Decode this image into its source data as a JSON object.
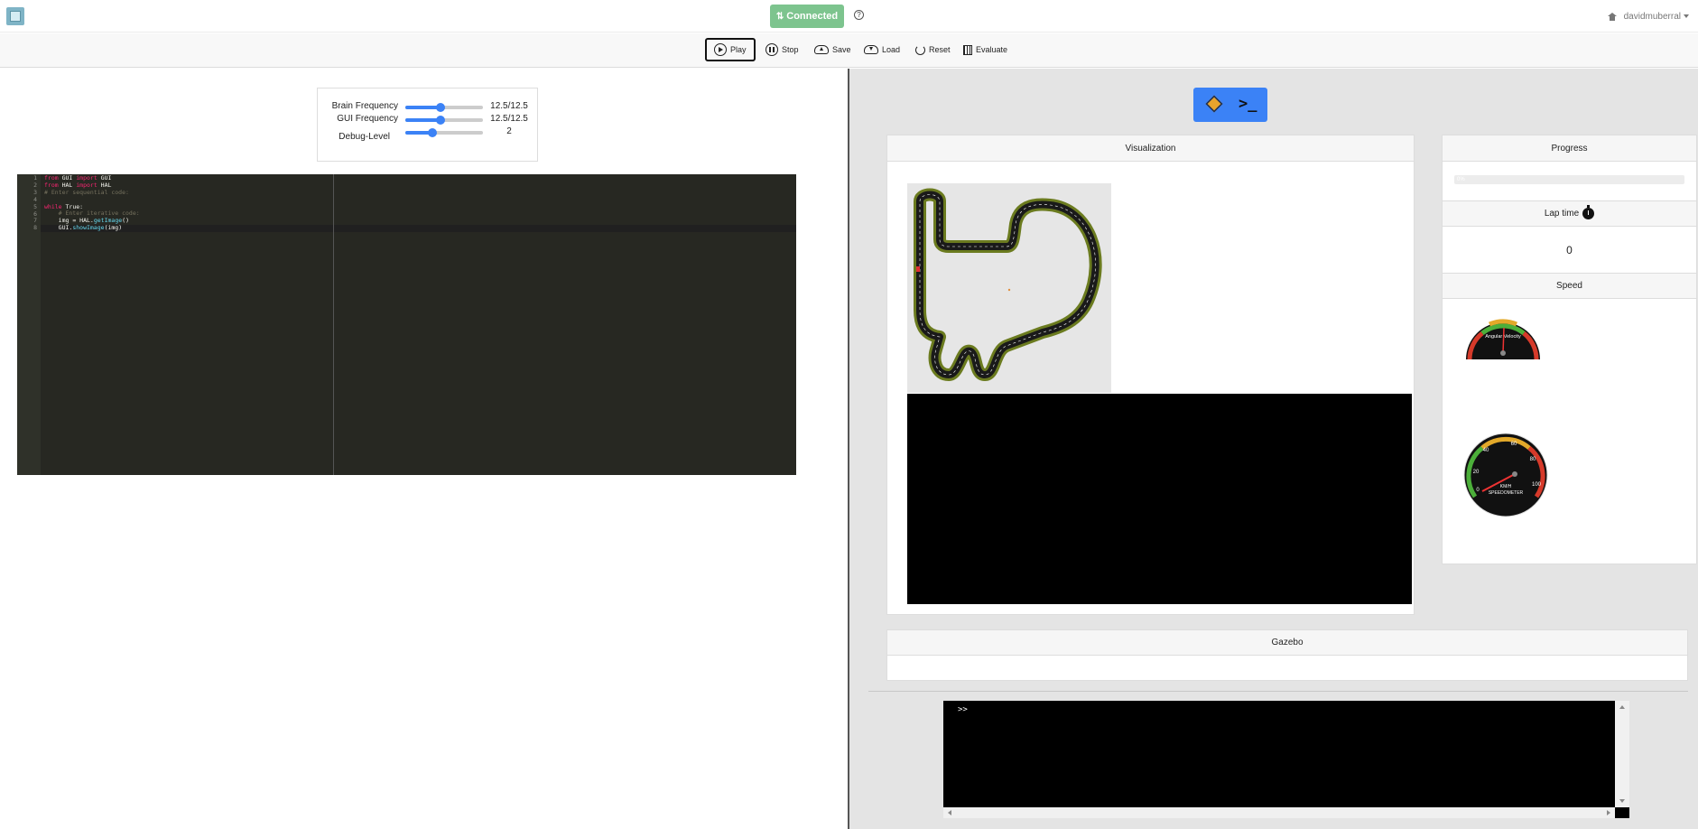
{
  "header": {
    "connection_status": "Connected",
    "help_symbol": "?",
    "username": "davidmuberral"
  },
  "toolbar": {
    "play": "Play",
    "stop": "Stop",
    "save": "Save",
    "load": "Load",
    "reset": "Reset",
    "evaluate": "Evaluate"
  },
  "frequencies": {
    "brain": {
      "label": "Brain Frequency",
      "value": "12.5/12.5",
      "level": 0.45
    },
    "gui": {
      "label": "GUI Frequency",
      "value": "12.5/12.5",
      "level": 0.45
    },
    "debug": {
      "label": "Debug-Level",
      "value": "2",
      "level": 0.35
    }
  },
  "editor": {
    "line_numbers": [
      "1",
      "2",
      "3",
      "4",
      "5",
      "6",
      "7",
      "8"
    ],
    "lines": [
      "from GUI import GUI",
      "from HAL import HAL",
      "# Enter sequential code:",
      "",
      "while True:",
      "    # Enter iterative code:",
      "    img = HAL.getImage()",
      "    GUI.showImage(img)"
    ]
  },
  "panels": {
    "visualization": "Visualization",
    "progress": "Progress",
    "progress_text": "0%",
    "lap_time": "Lap time",
    "lap_value": "0",
    "speed": "Speed",
    "gazebo": "Gazebo"
  },
  "gauges": {
    "angular": {
      "label": "Angular Velocity"
    },
    "speedometer": {
      "unit": "KM/H",
      "label": "SPEEDOMETER",
      "ticks": [
        "0",
        "20",
        "40",
        "60",
        "80",
        "100"
      ]
    }
  },
  "console": {
    "prompt": ">>"
  },
  "icons": [
    "logo-icon",
    "swap-icon",
    "help-icon",
    "home-icon",
    "play-icon",
    "pause-icon",
    "cloud-upload-icon",
    "cloud-download-icon",
    "reset-icon",
    "evaluate-icon",
    "cube-icon",
    "terminal-icon",
    "stopwatch-icon"
  ],
  "colors": {
    "accent": "#3b82f6",
    "connected": "#7dc48e",
    "editor_bg": "#272822",
    "track_green": "#6b7b1f"
  }
}
